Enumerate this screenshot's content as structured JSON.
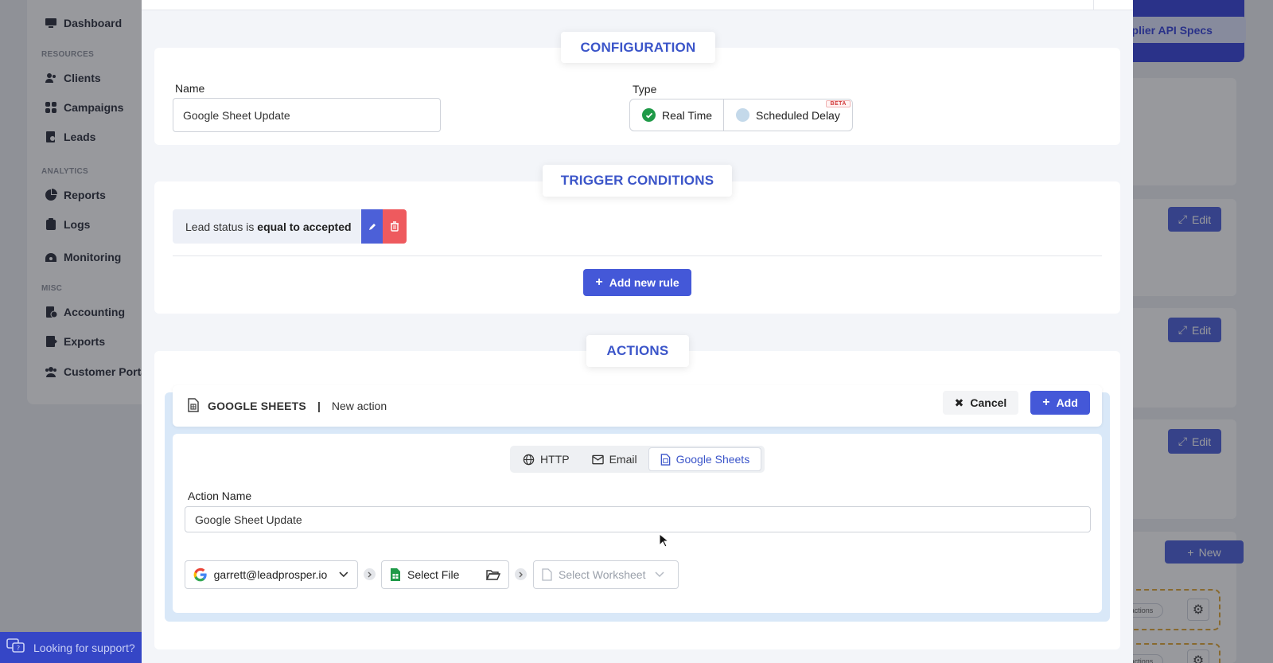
{
  "sidebar": {
    "top_item": "Dashboard",
    "sections": [
      {
        "title": "RESOURCES",
        "items": [
          "Clients",
          "Campaigns",
          "Leads"
        ]
      },
      {
        "title": "ANALYTICS",
        "items": [
          "Reports",
          "Logs",
          "Monitoring"
        ]
      },
      {
        "title": "MISC",
        "items": [
          "Accounting",
          "Exports",
          "Customer Porta"
        ]
      }
    ]
  },
  "background": {
    "api_specs_label": "pplier API Specs",
    "edit_label": "Edit",
    "new_label": "New",
    "pill_label": "actions"
  },
  "support": {
    "label": "Looking for support?"
  },
  "configuration": {
    "title": "CONFIGURATION",
    "name_label": "Name",
    "name_value": "Google Sheet Update",
    "type_label": "Type",
    "type_options": [
      "Real Time",
      "Scheduled Delay"
    ],
    "type_selected": "Real Time",
    "beta_badge": "BETA"
  },
  "trigger": {
    "title": "TRIGGER CONDITIONS",
    "rule_prefix": "Lead status is ",
    "rule_bold": "equal to accepted",
    "add_rule_label": "Add new rule"
  },
  "actions": {
    "title": "ACTIONS",
    "header_title": "GOOGLE SHEETS",
    "header_separator": "|",
    "header_subtitle": "New action",
    "cancel_label": "Cancel",
    "add_label": "Add",
    "tabs": [
      "HTTP",
      "Email",
      "Google Sheets"
    ],
    "active_tab": "Google Sheets",
    "action_name_label": "Action Name",
    "action_name_value": "Google Sheet Update",
    "account_value": "garrett@leadprosper.io",
    "file_placeholder": "Select File",
    "worksheet_placeholder": "Select Worksheet"
  },
  "colors": {
    "primary": "#4458d8",
    "section_title": "#3b55c9",
    "danger": "#ee5a5e",
    "success": "#1f9a48"
  }
}
